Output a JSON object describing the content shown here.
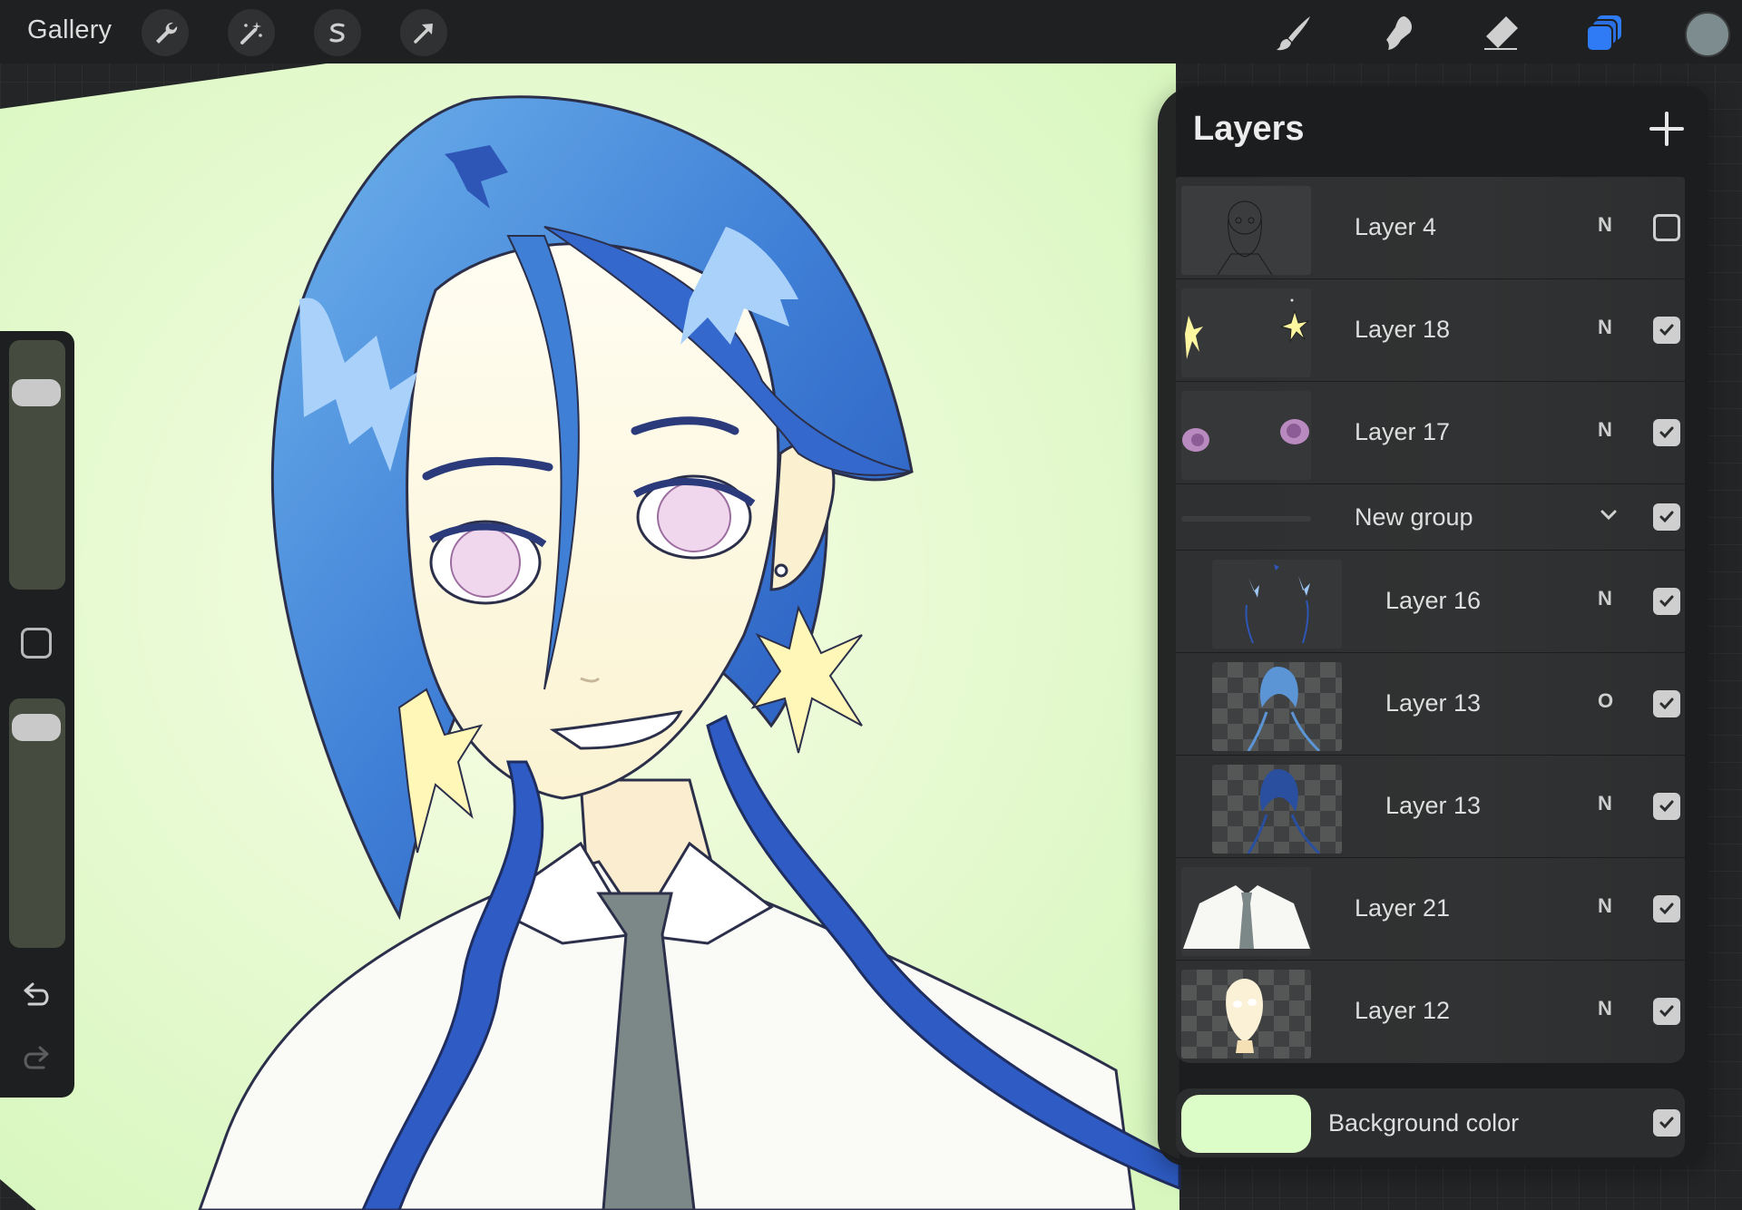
{
  "toolbar": {
    "gallery_label": "Gallery",
    "left_tools": [
      "wrench-icon",
      "magic-wand-icon",
      "selection-s-icon",
      "transform-arrow-icon"
    ],
    "right_tools": [
      "brush-icon",
      "smudge-icon",
      "eraser-icon",
      "layers-icon"
    ],
    "active_tool": "layers-icon",
    "accent_color": "#2f7bf6",
    "current_color": "#7d8c8f"
  },
  "sidebar": {
    "brush_size_level": 0.84,
    "opacity_level": 0.95
  },
  "layers_panel": {
    "title": "Layers",
    "add_icon": "plus-icon",
    "layers": [
      {
        "name": "Layer 4",
        "blend": "N",
        "visible": false,
        "indent": false,
        "thumb": "sketch"
      },
      {
        "name": "Layer 18",
        "blend": "N",
        "visible": true,
        "indent": false,
        "thumb": "sparkles"
      },
      {
        "name": "Layer 17",
        "blend": "N",
        "visible": true,
        "indent": false,
        "thumb": "eyes"
      },
      {
        "name": "New group",
        "blend": "",
        "visible": true,
        "indent": false,
        "group": true
      },
      {
        "name": "Layer 16",
        "blend": "N",
        "visible": true,
        "indent": true,
        "thumb": "hair-highlights"
      },
      {
        "name": "Layer 13",
        "blend": "O",
        "visible": true,
        "indent": true,
        "thumb": "hair-light"
      },
      {
        "name": "Layer 13",
        "blend": "N",
        "visible": true,
        "indent": true,
        "thumb": "hair-dark"
      },
      {
        "name": "Layer 21",
        "blend": "N",
        "visible": true,
        "indent": false,
        "thumb": "shirt"
      },
      {
        "name": "Layer 12",
        "blend": "N",
        "visible": true,
        "indent": false,
        "thumb": "face"
      }
    ],
    "background": {
      "label": "Background color",
      "color": "#dcfcc8",
      "visible": true
    }
  }
}
